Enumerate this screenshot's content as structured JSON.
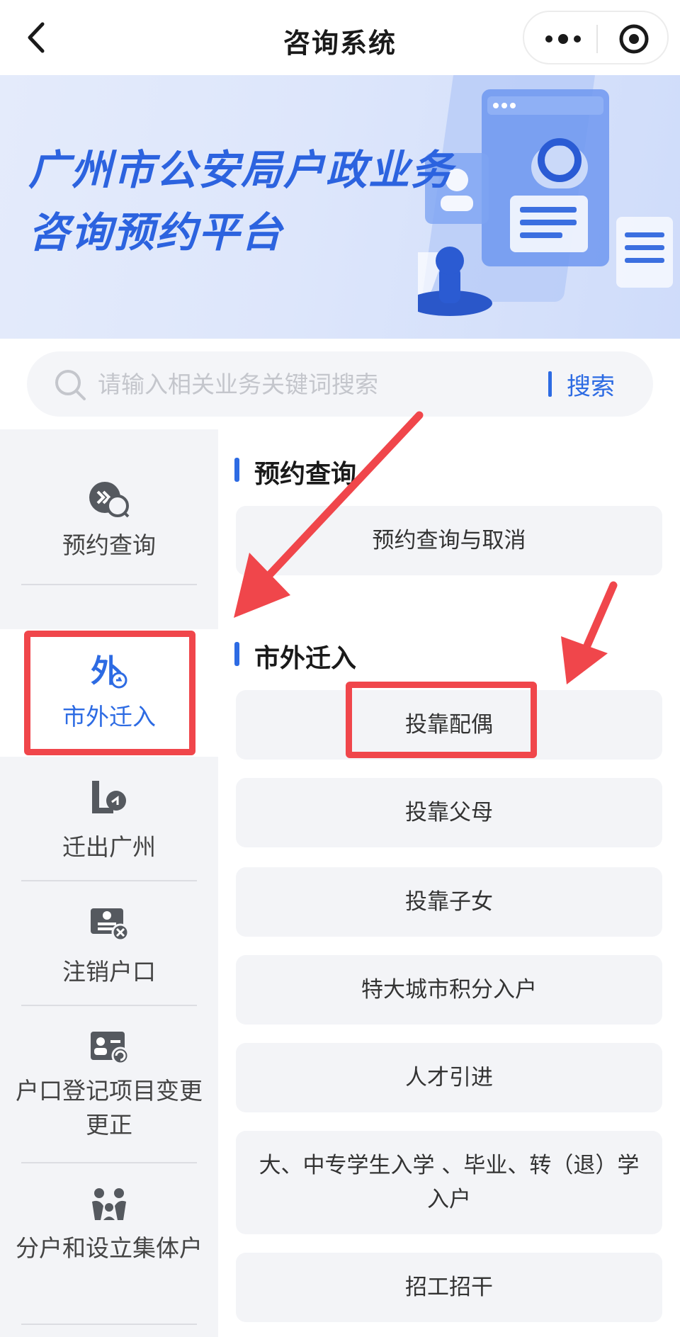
{
  "navbar": {
    "title": "咨询系统",
    "back_icon": "chevron-left-icon",
    "more_icon": "more-dots-icon",
    "target_icon": "target-icon"
  },
  "banner": {
    "line1": "广州市公安局户政业务",
    "line2": "咨询预约平台"
  },
  "search": {
    "placeholder": "请输入相关业务关键词搜索",
    "button_label": "搜索"
  },
  "sidebar": {
    "items": [
      {
        "label": "预约查询",
        "icon": "calendar-search-icon"
      },
      {
        "label": "市外迁入",
        "icon": "move-in-icon"
      },
      {
        "label": "迁出广州",
        "icon": "move-out-icon"
      },
      {
        "label": "注销户口",
        "icon": "cancel-registration-icon"
      },
      {
        "label": "户口登记项目变更更正",
        "icon": "id-card-change-icon"
      },
      {
        "label": "分户和设立集体户",
        "icon": "family-icon"
      }
    ]
  },
  "sections": [
    {
      "title": "预约查询",
      "options": [
        "预约查询与取消"
      ]
    },
    {
      "title": "市外迁入",
      "options": [
        "投靠配偶",
        "投靠父母",
        "投靠子女",
        "特大城市积分入户",
        "人才引进",
        "大、中专学生入学 、毕业、转（退）学入户",
        "招工招干"
      ]
    }
  ],
  "colors": {
    "accent": "#2d6be3",
    "annotation_red": "#f0464b",
    "panel_bg": "#f3f4f7"
  }
}
